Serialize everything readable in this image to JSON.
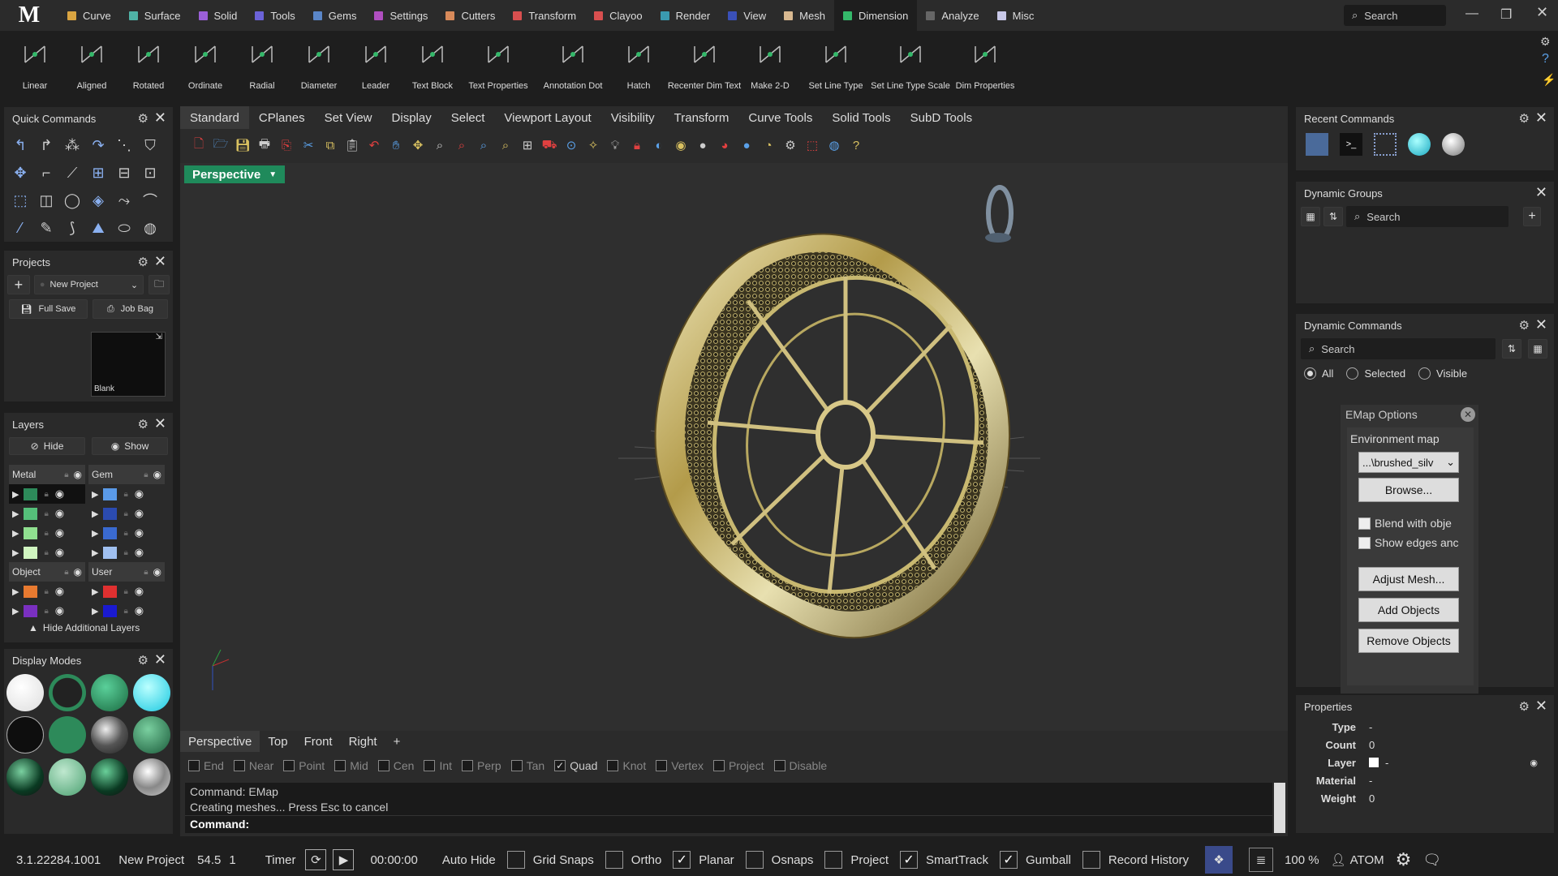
{
  "app": {
    "logo": "M"
  },
  "menu": [
    {
      "label": "Curve",
      "color": "#d9a441"
    },
    {
      "label": "Surface",
      "color": "#4fb3a6"
    },
    {
      "label": "Solid",
      "color": "#9b5fd8"
    },
    {
      "label": "Tools",
      "color": "#6b62d8"
    },
    {
      "label": "Gems",
      "color": "#5a86c8"
    },
    {
      "label": "Settings",
      "color": "#b04fc0"
    },
    {
      "label": "Cutters",
      "color": "#d88a5a"
    },
    {
      "label": "Transform",
      "color": "#d84f4f"
    },
    {
      "label": "Clayoo",
      "color": "#d84f4f"
    },
    {
      "label": "Render",
      "color": "#3a9ab0"
    },
    {
      "label": "View",
      "color": "#3a50b8"
    },
    {
      "label": "Mesh",
      "color": "#d8b890"
    },
    {
      "label": "Dimension",
      "color": "#34b86a",
      "active": true
    },
    {
      "label": "Analyze",
      "color": "#666"
    },
    {
      "label": "Misc",
      "color": "#c8c8e8"
    }
  ],
  "topsearch": {
    "placeholder": "Search"
  },
  "ribbon": [
    "Linear",
    "Aligned",
    "Rotated",
    "Ordinate",
    "Radial",
    "Diameter",
    "Leader",
    "Text Block",
    "Text Properties",
    "Annotation Dot",
    "Hatch",
    "Recenter Dim Text",
    "Make 2-D",
    "Set Line Type",
    "Set Line Type Scale",
    "Dim Properties"
  ],
  "quick_commands": {
    "title": "Quick Commands"
  },
  "projects": {
    "title": "Projects",
    "project_name": "New Project",
    "full_save": "Full Save",
    "job_bag": "Job Bag",
    "thumb_label": "Blank"
  },
  "layers": {
    "title": "Layers",
    "hide": "Hide",
    "show": "Show",
    "groups": [
      {
        "name": "Metal",
        "colors": [
          "#2d8a5a",
          "#55c07a",
          "#90e090",
          "#d0f5c0"
        ]
      },
      {
        "name": "Gem",
        "colors": [
          "#5a9ae8",
          "#2b4bb0",
          "#3a6ad0",
          "#a0c0f0"
        ]
      },
      {
        "name": "Object",
        "colors": [
          "#e87a30",
          "#7a30c0"
        ]
      },
      {
        "name": "User",
        "colors": [
          "#e03030",
          "#1a1ad0"
        ]
      }
    ],
    "footer": "Hide Additional Layers"
  },
  "display_modes": {
    "title": "Display Modes"
  },
  "viewport_toolbar_tabs": [
    "Standard",
    "CPlanes",
    "Set View",
    "Display",
    "Select",
    "Viewport Layout",
    "Visibility",
    "Transform",
    "Curve Tools",
    "Solid Tools",
    "SubD Tools"
  ],
  "viewport": {
    "title": "Perspective"
  },
  "bottom_tabs": [
    "Perspective",
    "Top",
    "Front",
    "Right"
  ],
  "osnaps": [
    {
      "label": "End",
      "on": false
    },
    {
      "label": "Near",
      "on": false
    },
    {
      "label": "Point",
      "on": false
    },
    {
      "label": "Mid",
      "on": false
    },
    {
      "label": "Cen",
      "on": false
    },
    {
      "label": "Int",
      "on": false
    },
    {
      "label": "Perp",
      "on": false
    },
    {
      "label": "Tan",
      "on": false
    },
    {
      "label": "Quad",
      "on": true
    },
    {
      "label": "Knot",
      "on": false
    },
    {
      "label": "Vertex",
      "on": false
    },
    {
      "label": "Project",
      "on": false
    },
    {
      "label": "Disable",
      "on": false
    }
  ],
  "command": {
    "history": [
      "Command: EMap",
      "Creating meshes... Press Esc to cancel"
    ],
    "prompt": "Command:"
  },
  "status": {
    "version": "3.1.22284.1001",
    "project": "New Project",
    "units": "54.5",
    "units2": "1",
    "timer": "Timer",
    "time": "00:00:00",
    "items": [
      {
        "label": "Auto Hide",
        "on": false
      },
      {
        "label": "Grid Snaps",
        "on": false
      },
      {
        "label": "Ortho",
        "on": false
      },
      {
        "label": "Planar",
        "on": true
      },
      {
        "label": "Osnaps",
        "on": false
      },
      {
        "label": "Project",
        "on": false
      },
      {
        "label": "SmartTrack",
        "on": true
      },
      {
        "label": "Gumball",
        "on": true
      },
      {
        "label": "Record History",
        "on": false
      }
    ],
    "zoom": "100 %",
    "user": "ATOM"
  },
  "recent_commands": {
    "title": "Recent Commands"
  },
  "dynamic_groups": {
    "title": "Dynamic Groups",
    "search": "Search"
  },
  "dynamic_commands": {
    "title": "Dynamic Commands",
    "search": "Search",
    "radios": [
      {
        "label": "All",
        "on": true
      },
      {
        "label": "Selected",
        "on": false
      },
      {
        "label": "Visible",
        "on": false
      }
    ]
  },
  "emap": {
    "title": "EMap Options",
    "env_label": "Environment map",
    "env_value": "...\\brushed_silv",
    "browse": "Browse...",
    "blend": "Blend with obje",
    "edges": "Show edges anc",
    "adjust": "Adjust Mesh...",
    "add": "Add Objects",
    "remove": "Remove Objects"
  },
  "properties": {
    "title": "Properties",
    "rows": [
      {
        "k": "Type",
        "v": "-"
      },
      {
        "k": "Count",
        "v": "0"
      },
      {
        "k": "Layer",
        "v": "-"
      },
      {
        "k": "Material",
        "v": "-"
      },
      {
        "k": "Weight",
        "v": "0"
      }
    ]
  }
}
